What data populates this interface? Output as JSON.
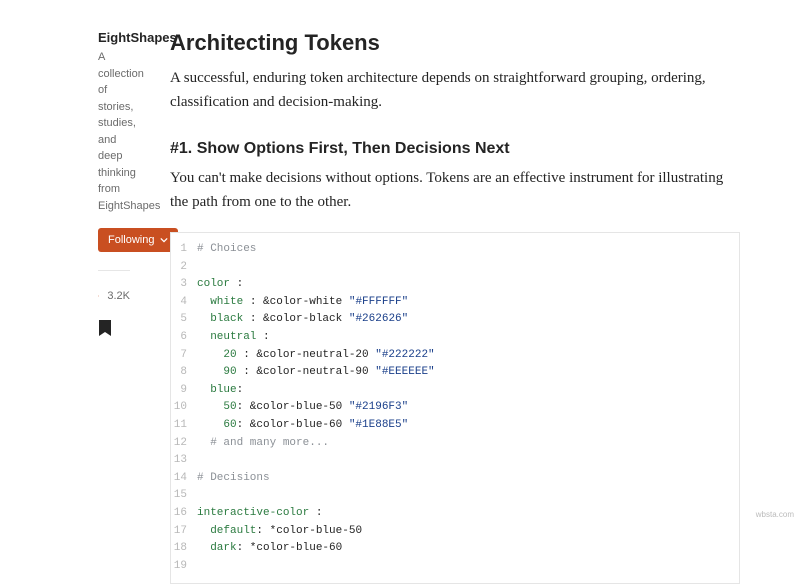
{
  "sidebar": {
    "title": "EightShapes",
    "description": "A collection of stories, studies, and deep thinking from EightShapes",
    "follow_label": "Following",
    "clap_count": "3.2K"
  },
  "article": {
    "h1": "Architecting Tokens",
    "subtitle": "A successful, enduring token architecture depends on straightforward grouping, ordering, classification and decision-making.",
    "h2": "#1. Show Options First, Then Decisions Next",
    "para": "You can't make decisions without options. Tokens are an effective instrument for illustrating the path from one to the other."
  },
  "code": {
    "lines": [
      {
        "n": "1",
        "tokens": [
          [
            "comment",
            "# Choices"
          ]
        ]
      },
      {
        "n": "2",
        "tokens": []
      },
      {
        "n": "3",
        "tokens": [
          [
            "key",
            "color"
          ],
          [
            "plain",
            " :"
          ]
        ]
      },
      {
        "n": "4",
        "tokens": [
          [
            "plain",
            "  "
          ],
          [
            "key",
            "white"
          ],
          [
            "plain",
            " : &color-white "
          ],
          [
            "str",
            "\"#FFFFFF\""
          ]
        ]
      },
      {
        "n": "5",
        "tokens": [
          [
            "plain",
            "  "
          ],
          [
            "key",
            "black"
          ],
          [
            "plain",
            " : &color-black "
          ],
          [
            "str",
            "\"#262626\""
          ]
        ]
      },
      {
        "n": "6",
        "tokens": [
          [
            "plain",
            "  "
          ],
          [
            "key",
            "neutral"
          ],
          [
            "plain",
            " :"
          ]
        ]
      },
      {
        "n": "7",
        "tokens": [
          [
            "plain",
            "    "
          ],
          [
            "key",
            "20"
          ],
          [
            "plain",
            " : &color-neutral-20 "
          ],
          [
            "str",
            "\"#222222\""
          ]
        ]
      },
      {
        "n": "8",
        "tokens": [
          [
            "plain",
            "    "
          ],
          [
            "key",
            "90"
          ],
          [
            "plain",
            " : &color-neutral-90 "
          ],
          [
            "str",
            "\"#EEEEEE\""
          ]
        ]
      },
      {
        "n": "9",
        "tokens": [
          [
            "plain",
            "  "
          ],
          [
            "key",
            "blue"
          ],
          [
            "plain",
            ":"
          ]
        ]
      },
      {
        "n": "10",
        "tokens": [
          [
            "plain",
            "    "
          ],
          [
            "key",
            "50"
          ],
          [
            "plain",
            ": &color-blue-50 "
          ],
          [
            "str",
            "\"#2196F3\""
          ]
        ]
      },
      {
        "n": "11",
        "tokens": [
          [
            "plain",
            "    "
          ],
          [
            "key",
            "60"
          ],
          [
            "plain",
            ": &color-blue-60 "
          ],
          [
            "str",
            "\"#1E88E5\""
          ]
        ]
      },
      {
        "n": "12",
        "tokens": [
          [
            "plain",
            "  "
          ],
          [
            "comment",
            "# and many more..."
          ]
        ]
      },
      {
        "n": "13",
        "tokens": []
      },
      {
        "n": "14",
        "tokens": [
          [
            "comment",
            "# Decisions"
          ]
        ]
      },
      {
        "n": "15",
        "tokens": []
      },
      {
        "n": "16",
        "tokens": [
          [
            "key",
            "interactive-color"
          ],
          [
            "plain",
            " :"
          ]
        ]
      },
      {
        "n": "17",
        "tokens": [
          [
            "plain",
            "  "
          ],
          [
            "key",
            "default"
          ],
          [
            "plain",
            ": *color-blue-50"
          ]
        ]
      },
      {
        "n": "18",
        "tokens": [
          [
            "plain",
            "  "
          ],
          [
            "key",
            "dark"
          ],
          [
            "plain",
            ": *color-blue-60"
          ]
        ]
      },
      {
        "n": "19",
        "tokens": []
      }
    ]
  },
  "attribution": "wbsta.com"
}
